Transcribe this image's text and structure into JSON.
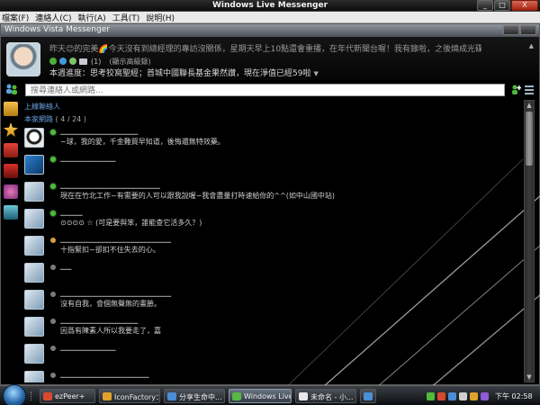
{
  "window": {
    "title": "Windows Live Messenger",
    "buttons": [
      "_",
      "□",
      "X"
    ]
  },
  "menu": [
    "檔案(F)",
    "連絡人(C)",
    "執行(A)",
    "工具(T)",
    "說明(H)"
  ],
  "inner_window": {
    "title": "Windows Vista Messenger"
  },
  "profile": {
    "status_message": "昨天😊的完美🌈今天沒有到總經理的專訪沒關係，星期天早上10點還會重播，在年代新聞台喔！我有錄啦，之後燒成光碟一看到總經理上電視超興奮！",
    "mail_count": "(1)",
    "display_name": "(顯示高級錄)",
    "now_playing": "本週進度：思考狡窩聖經；首城中國聯長基金果然讚，現在淨值已經59啦",
    "scroll_caret": "▲",
    "caret": "▼"
  },
  "search": {
    "placeholder": "搜尋連絡人或網路..."
  },
  "contacts": {
    "group_label": "上線聯絡人",
    "group_name": "本家網路",
    "group_count": "( 4 / 24 )",
    "items": [
      {
        "name": "▁▁▁▁▁▁▁▁▁▁▁▁▁▁",
        "message": "~球，我的愛，千金難買早知道，後悔還無特效藥。",
        "presence": "online"
      },
      {
        "name": "▁▁▁▁▁▁▁▁▁▁",
        "message": "",
        "presence": "online"
      },
      {
        "name": "▁▁▁▁▁▁▁▁▁▁▁▁▁▁▁▁▁▁",
        "message": "現在在竹北工作~有需要的人可以跟我說喔~我會盡量打時速給你的^^(如中山國中站)",
        "presence": "online"
      },
      {
        "name": "▁▁▁▁",
        "message": "⊙⊙⊙⊙ ☆ (可是要與笨，誰能查它活多久？)",
        "presence": "online"
      },
      {
        "name": "▁▁▁▁▁▁▁▁▁▁▁▁▁▁▁▁▁▁▁▁",
        "message": "十指緊扣~卻扣不住失去的心。",
        "presence": "away"
      },
      {
        "name": "▁▁",
        "message": "",
        "presence": "offline"
      },
      {
        "name": "▁▁▁▁▁▁▁▁▁▁▁▁▁▁▁▁▁▁▁▁",
        "message": "沒有自我，會個無聲無的畫臉。",
        "presence": "offline"
      },
      {
        "name": "▁▁▁▁▁▁▁▁▁▁▁▁▁▁",
        "message": "因爲有陳素人所以我要走了，嘉",
        "presence": "offline"
      },
      {
        "name": "▁▁▁▁▁▁▁▁▁▁",
        "message": "",
        "presence": "offline"
      },
      {
        "name": "▁▁▁▁▁▁▁▁▁▁▁▁▁▁▁▁",
        "message": "",
        "presence": "offline"
      }
    ]
  },
  "taskbar": {
    "tasks": [
      {
        "label": "ezPeer+",
        "color": "#d84a2f"
      },
      {
        "label": "IconFactory：...",
        "color": "#e0a22b"
      },
      {
        "label": "分享生命中...",
        "color": "#4a8fd6"
      },
      {
        "label": "Windows Live...",
        "color": "#59b547"
      },
      {
        "label": "未命名 - 小...",
        "color": "#e8e8e8"
      },
      {
        "label": "",
        "color": "#4a8fd6"
      }
    ],
    "clock": "下午 02:58"
  },
  "colors": {
    "accent_blue": "#6aa3e4",
    "online": "#4ebb3b",
    "away": "#d6a13e"
  }
}
